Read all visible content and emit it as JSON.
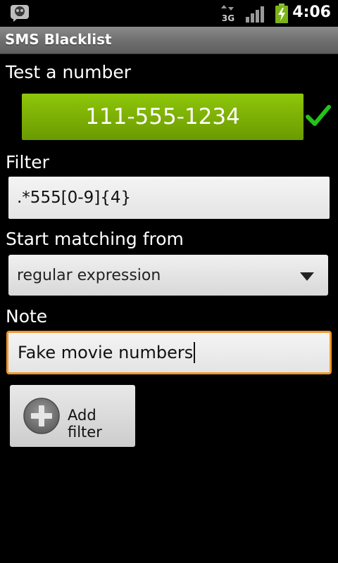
{
  "status_bar": {
    "time": "4:06",
    "network": "3G",
    "icons": [
      "notification-skull-icon",
      "network-3g-icon",
      "signal-icon",
      "battery-charging-icon"
    ]
  },
  "app": {
    "title": "SMS Blacklist"
  },
  "test": {
    "label": "Test a number",
    "number": "111-555-1234",
    "match_icon": "check-icon",
    "match_color": "#22c419"
  },
  "filter": {
    "label": "Filter",
    "value": ".*555[0-9]{4}"
  },
  "matching": {
    "label": "Start matching from",
    "selected": "regular expression"
  },
  "note": {
    "label": "Note",
    "value": "Fake movie numbers"
  },
  "actions": {
    "add_label": "Add filter"
  },
  "colors": {
    "accent_green": "#7db005",
    "focus_orange": "#f0962a"
  }
}
